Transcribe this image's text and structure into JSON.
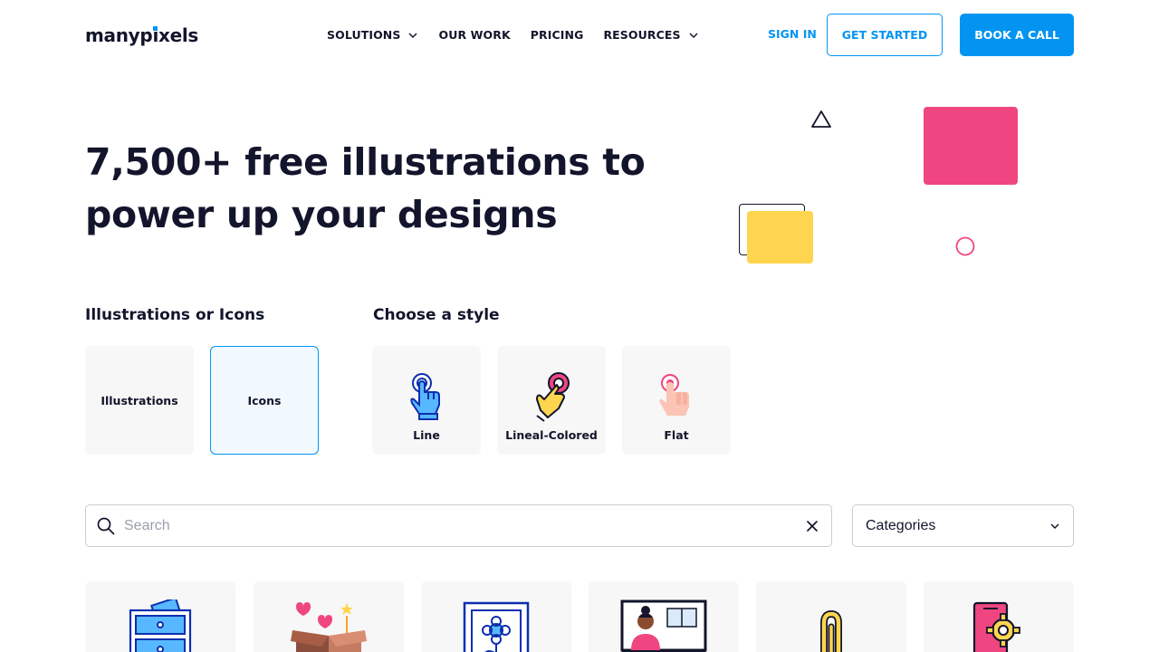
{
  "header": {
    "logo_text": "manypixels",
    "nav": [
      {
        "label": "SOLUTIONS",
        "has_dropdown": true
      },
      {
        "label": "OUR WORK",
        "has_dropdown": false
      },
      {
        "label": "PRICING",
        "has_dropdown": false
      },
      {
        "label": "RESOURCES",
        "has_dropdown": true
      }
    ],
    "sign_in": "SIGN IN",
    "get_started": "GET STARTED",
    "book_call": "BOOK A CALL"
  },
  "hero": {
    "title_line1": "7,500+ free illustrations to",
    "title_line2": "power up your designs"
  },
  "type_section": {
    "label": "Illustrations or Icons",
    "options": [
      {
        "label": "Illustrations",
        "selected": false
      },
      {
        "label": "Icons",
        "selected": true
      }
    ]
  },
  "style_section": {
    "label": "Choose a style",
    "options": [
      {
        "label": "Line",
        "icon": "hand-pointer-line-icon"
      },
      {
        "label": "Lineal-Colored",
        "icon": "hand-pointer-lineal-colored-icon"
      },
      {
        "label": "Flat",
        "icon": "hand-pointer-flat-icon"
      }
    ]
  },
  "search": {
    "placeholder": "Search",
    "value": ""
  },
  "categories": {
    "label": "Categories"
  },
  "grid_items": [
    {
      "icon": "file-cabinet-icon"
    },
    {
      "icon": "gift-box-hearts-icon"
    },
    {
      "icon": "framed-flower-icon"
    },
    {
      "icon": "video-call-icon"
    },
    {
      "icon": "paperclip-icon"
    },
    {
      "icon": "phone-settings-icon"
    }
  ],
  "colors": {
    "accent": "#0394f1",
    "text": "#12152b",
    "pink": "#ef4681",
    "yellow": "#fdd54f"
  }
}
